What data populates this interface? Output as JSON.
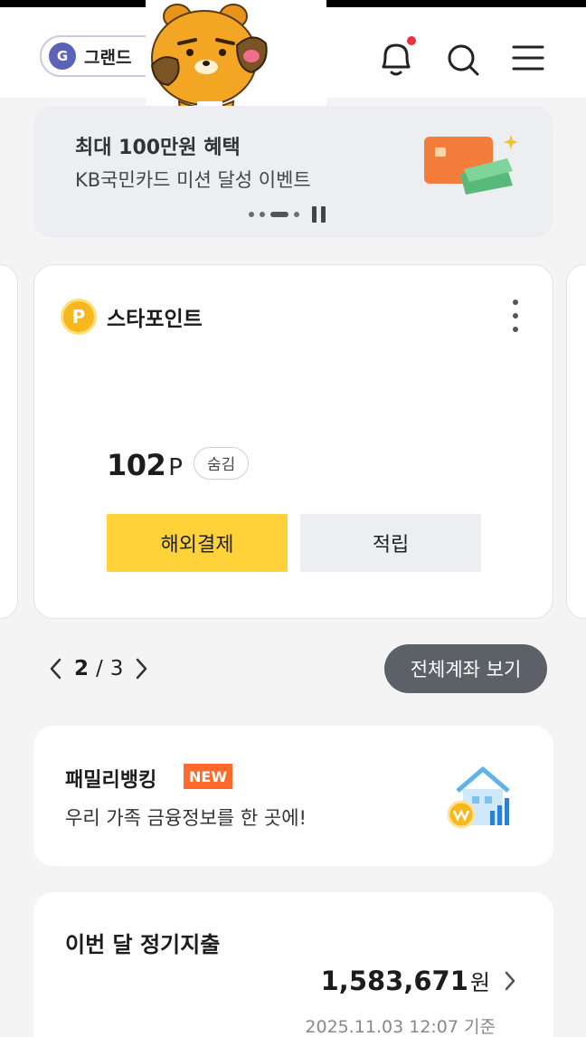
{
  "header": {
    "grade": {
      "letter": "G",
      "label": "그랜드"
    },
    "icons": [
      "bell-icon",
      "search-icon",
      "menu-icon"
    ],
    "notification_dot": true
  },
  "banner": {
    "title": "최대 100만원 혜택",
    "subtitle": "KB국민카드 미션 달성 이벤트",
    "slide_count": 4,
    "active_slide": 3
  },
  "point_card": {
    "badge_letter": "P",
    "title": "스타포인트",
    "amount": "102",
    "unit": "P",
    "hide_label": "숨김",
    "primary_button": "해외결제",
    "secondary_button": "적립"
  },
  "pager": {
    "current": "2",
    "separator": "/",
    "total": "3",
    "all_accounts_label": "전체계좌 보기"
  },
  "family_banking": {
    "title": "패밀리뱅킹",
    "badge": "NEW",
    "subtitle": "우리 가족 금융정보를 한 곳에!"
  },
  "regular_expense": {
    "title": "이번 달 정기지출",
    "amount": "1,583,671",
    "unit": "원",
    "timestamp": "2025.11.03 12:07 기준"
  },
  "colors": {
    "accent_yellow": "#ffd23a",
    "grade_blue": "#5b63b7",
    "new_badge": "#ff6a2a",
    "notification_red": "#e8323c",
    "dark_button": "#5c6067"
  }
}
